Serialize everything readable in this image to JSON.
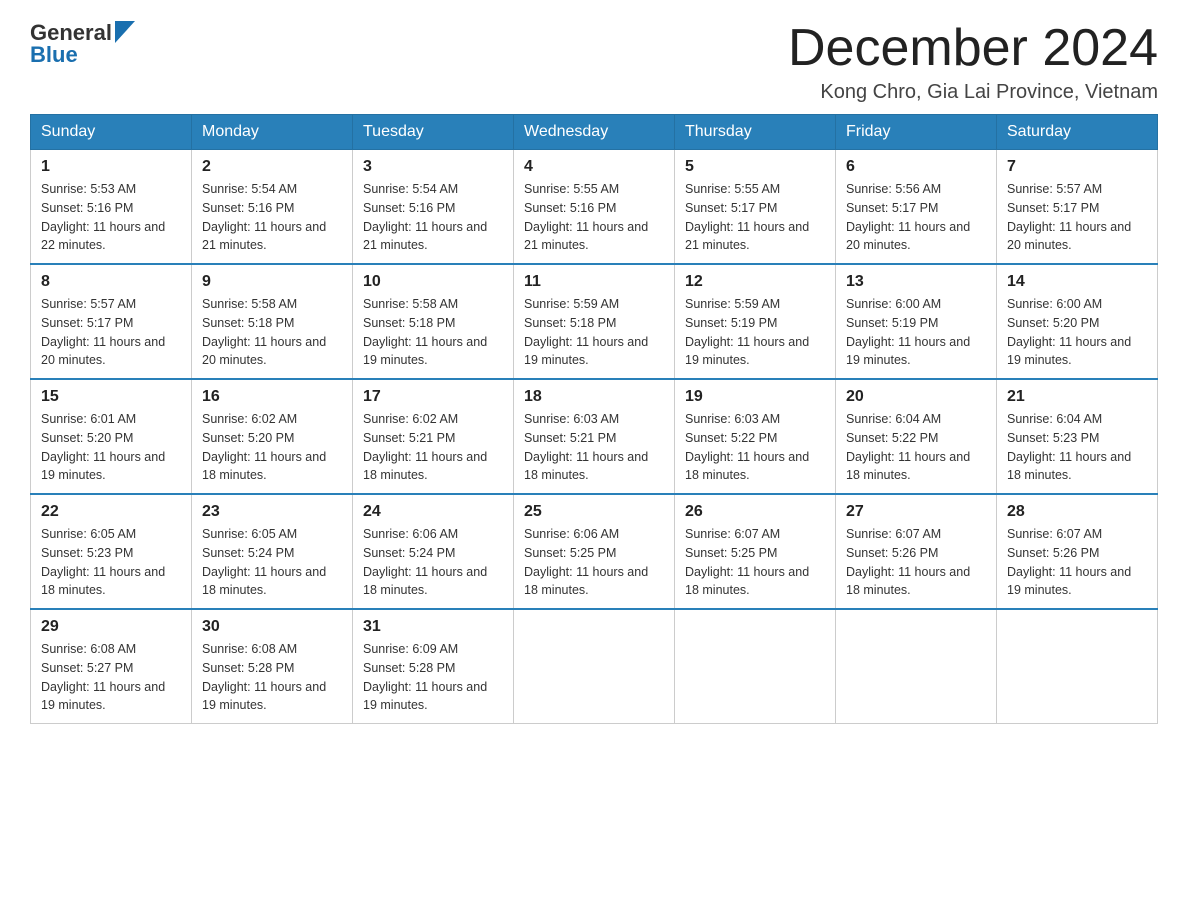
{
  "header": {
    "logo_general": "General",
    "logo_blue": "Blue",
    "month_title": "December 2024",
    "location": "Kong Chro, Gia Lai Province, Vietnam"
  },
  "days_of_week": [
    "Sunday",
    "Monday",
    "Tuesday",
    "Wednesday",
    "Thursday",
    "Friday",
    "Saturday"
  ],
  "weeks": [
    [
      {
        "day": "1",
        "sunrise": "5:53 AM",
        "sunset": "5:16 PM",
        "daylight": "11 hours and 22 minutes."
      },
      {
        "day": "2",
        "sunrise": "5:54 AM",
        "sunset": "5:16 PM",
        "daylight": "11 hours and 21 minutes."
      },
      {
        "day": "3",
        "sunrise": "5:54 AM",
        "sunset": "5:16 PM",
        "daylight": "11 hours and 21 minutes."
      },
      {
        "day": "4",
        "sunrise": "5:55 AM",
        "sunset": "5:16 PM",
        "daylight": "11 hours and 21 minutes."
      },
      {
        "day": "5",
        "sunrise": "5:55 AM",
        "sunset": "5:17 PM",
        "daylight": "11 hours and 21 minutes."
      },
      {
        "day": "6",
        "sunrise": "5:56 AM",
        "sunset": "5:17 PM",
        "daylight": "11 hours and 20 minutes."
      },
      {
        "day": "7",
        "sunrise": "5:57 AM",
        "sunset": "5:17 PM",
        "daylight": "11 hours and 20 minutes."
      }
    ],
    [
      {
        "day": "8",
        "sunrise": "5:57 AM",
        "sunset": "5:17 PM",
        "daylight": "11 hours and 20 minutes."
      },
      {
        "day": "9",
        "sunrise": "5:58 AM",
        "sunset": "5:18 PM",
        "daylight": "11 hours and 20 minutes."
      },
      {
        "day": "10",
        "sunrise": "5:58 AM",
        "sunset": "5:18 PM",
        "daylight": "11 hours and 19 minutes."
      },
      {
        "day": "11",
        "sunrise": "5:59 AM",
        "sunset": "5:18 PM",
        "daylight": "11 hours and 19 minutes."
      },
      {
        "day": "12",
        "sunrise": "5:59 AM",
        "sunset": "5:19 PM",
        "daylight": "11 hours and 19 minutes."
      },
      {
        "day": "13",
        "sunrise": "6:00 AM",
        "sunset": "5:19 PM",
        "daylight": "11 hours and 19 minutes."
      },
      {
        "day": "14",
        "sunrise": "6:00 AM",
        "sunset": "5:20 PM",
        "daylight": "11 hours and 19 minutes."
      }
    ],
    [
      {
        "day": "15",
        "sunrise": "6:01 AM",
        "sunset": "5:20 PM",
        "daylight": "11 hours and 19 minutes."
      },
      {
        "day": "16",
        "sunrise": "6:02 AM",
        "sunset": "5:20 PM",
        "daylight": "11 hours and 18 minutes."
      },
      {
        "day": "17",
        "sunrise": "6:02 AM",
        "sunset": "5:21 PM",
        "daylight": "11 hours and 18 minutes."
      },
      {
        "day": "18",
        "sunrise": "6:03 AM",
        "sunset": "5:21 PM",
        "daylight": "11 hours and 18 minutes."
      },
      {
        "day": "19",
        "sunrise": "6:03 AM",
        "sunset": "5:22 PM",
        "daylight": "11 hours and 18 minutes."
      },
      {
        "day": "20",
        "sunrise": "6:04 AM",
        "sunset": "5:22 PM",
        "daylight": "11 hours and 18 minutes."
      },
      {
        "day": "21",
        "sunrise": "6:04 AM",
        "sunset": "5:23 PM",
        "daylight": "11 hours and 18 minutes."
      }
    ],
    [
      {
        "day": "22",
        "sunrise": "6:05 AM",
        "sunset": "5:23 PM",
        "daylight": "11 hours and 18 minutes."
      },
      {
        "day": "23",
        "sunrise": "6:05 AM",
        "sunset": "5:24 PM",
        "daylight": "11 hours and 18 minutes."
      },
      {
        "day": "24",
        "sunrise": "6:06 AM",
        "sunset": "5:24 PM",
        "daylight": "11 hours and 18 minutes."
      },
      {
        "day": "25",
        "sunrise": "6:06 AM",
        "sunset": "5:25 PM",
        "daylight": "11 hours and 18 minutes."
      },
      {
        "day": "26",
        "sunrise": "6:07 AM",
        "sunset": "5:25 PM",
        "daylight": "11 hours and 18 minutes."
      },
      {
        "day": "27",
        "sunrise": "6:07 AM",
        "sunset": "5:26 PM",
        "daylight": "11 hours and 18 minutes."
      },
      {
        "day": "28",
        "sunrise": "6:07 AM",
        "sunset": "5:26 PM",
        "daylight": "11 hours and 19 minutes."
      }
    ],
    [
      {
        "day": "29",
        "sunrise": "6:08 AM",
        "sunset": "5:27 PM",
        "daylight": "11 hours and 19 minutes."
      },
      {
        "day": "30",
        "sunrise": "6:08 AM",
        "sunset": "5:28 PM",
        "daylight": "11 hours and 19 minutes."
      },
      {
        "day": "31",
        "sunrise": "6:09 AM",
        "sunset": "5:28 PM",
        "daylight": "11 hours and 19 minutes."
      },
      null,
      null,
      null,
      null
    ]
  ]
}
